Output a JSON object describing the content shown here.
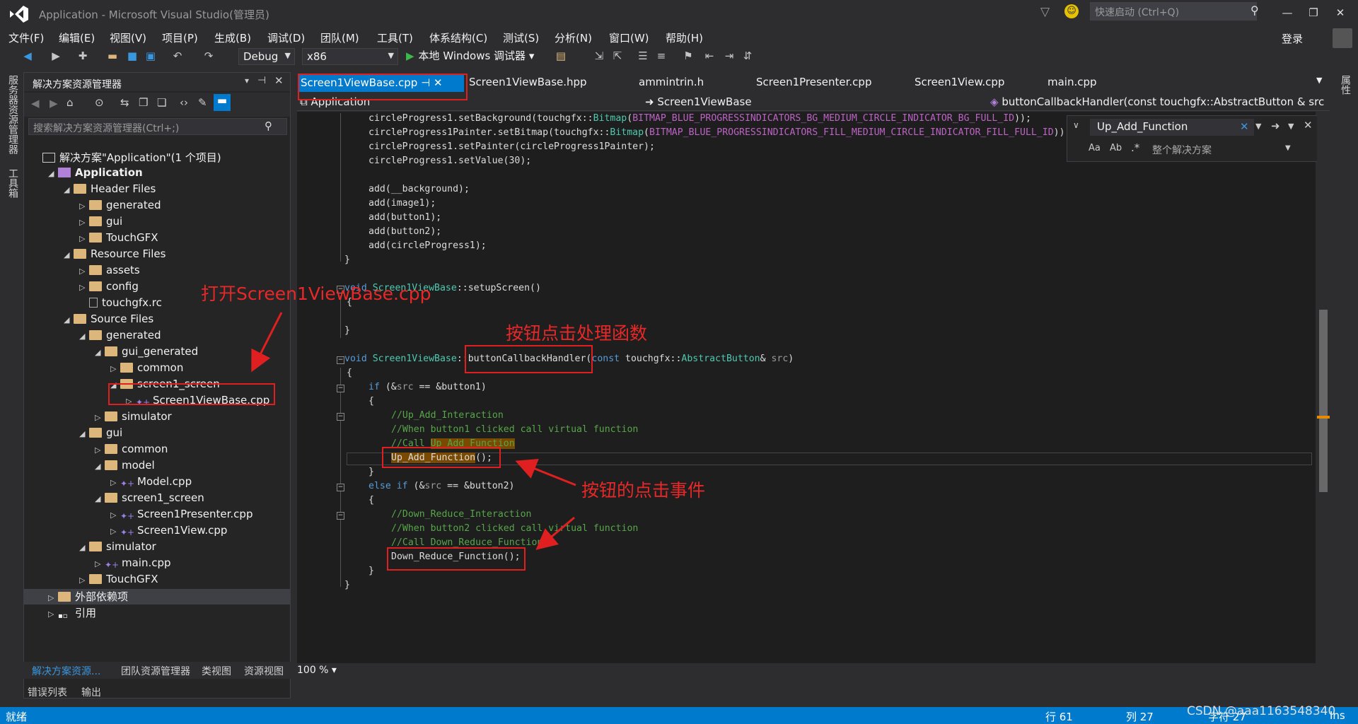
{
  "window": {
    "title": "Application - Microsoft Visual Studio(管理员)",
    "quick_launch_placeholder": "快速启动 (Ctrl+Q)",
    "login": "登录"
  },
  "menu": [
    "文件(F)",
    "编辑(E)",
    "视图(V)",
    "项目(P)",
    "生成(B)",
    "调试(D)",
    "团队(M)",
    "工具(T)",
    "体系结构(C)",
    "测试(S)",
    "分析(N)",
    "窗口(W)",
    "帮助(H)"
  ],
  "toolbar": {
    "config": "Debug",
    "platform": "x86",
    "run_label": "本地 Windows 调试器"
  },
  "left_strip": [
    "服务器资源管理器",
    "工具箱"
  ],
  "right_strip": [
    "属性"
  ],
  "solution_explorer": {
    "title": "解决方案资源管理器",
    "search_placeholder": "搜索解决方案资源管理器(Ctrl+;)",
    "tree": [
      {
        "label": "解决方案\"Application\"(1 个项目)",
        "indent": 0,
        "kind": "solution",
        "tri": ""
      },
      {
        "label": "Application",
        "indent": 1,
        "kind": "project",
        "tri": "◢",
        "bold": true
      },
      {
        "label": "Header Files",
        "indent": 2,
        "kind": "folder",
        "tri": "◢"
      },
      {
        "label": "generated",
        "indent": 3,
        "kind": "folder",
        "tri": "▷"
      },
      {
        "label": "gui",
        "indent": 3,
        "kind": "folder",
        "tri": "▷"
      },
      {
        "label": "TouchGFX",
        "indent": 3,
        "kind": "folder",
        "tri": "▷"
      },
      {
        "label": "Resource Files",
        "indent": 2,
        "kind": "folder",
        "tri": "◢"
      },
      {
        "label": "assets",
        "indent": 3,
        "kind": "folder",
        "tri": "▷"
      },
      {
        "label": "config",
        "indent": 3,
        "kind": "folder",
        "tri": "▷"
      },
      {
        "label": "touchgfx.rc",
        "indent": 3,
        "kind": "file",
        "tri": ""
      },
      {
        "label": "Source Files",
        "indent": 2,
        "kind": "folder",
        "tri": "◢"
      },
      {
        "label": "generated",
        "indent": 3,
        "kind": "folder",
        "tri": "◢"
      },
      {
        "label": "gui_generated",
        "indent": 4,
        "kind": "folder",
        "tri": "◢"
      },
      {
        "label": "common",
        "indent": 5,
        "kind": "folder",
        "tri": "▷"
      },
      {
        "label": "screen1_screen",
        "indent": 5,
        "kind": "folder",
        "tri": "◢"
      },
      {
        "label": "Screen1ViewBase.cpp",
        "indent": 6,
        "kind": "cpp",
        "tri": "▷"
      },
      {
        "label": "simulator",
        "indent": 4,
        "kind": "folder",
        "tri": "▷"
      },
      {
        "label": "gui",
        "indent": 3,
        "kind": "folder",
        "tri": "◢"
      },
      {
        "label": "common",
        "indent": 4,
        "kind": "folder",
        "tri": "▷"
      },
      {
        "label": "model",
        "indent": 4,
        "kind": "folder",
        "tri": "◢"
      },
      {
        "label": "Model.cpp",
        "indent": 5,
        "kind": "cpp",
        "tri": "▷"
      },
      {
        "label": "screen1_screen",
        "indent": 4,
        "kind": "folder",
        "tri": "◢"
      },
      {
        "label": "Screen1Presenter.cpp",
        "indent": 5,
        "kind": "cpp",
        "tri": "▷"
      },
      {
        "label": "Screen1View.cpp",
        "indent": 5,
        "kind": "cpp",
        "tri": "▷"
      },
      {
        "label": "simulator",
        "indent": 3,
        "kind": "folder",
        "tri": "◢"
      },
      {
        "label": "main.cpp",
        "indent": 4,
        "kind": "cpp",
        "tri": "▷"
      },
      {
        "label": "TouchGFX",
        "indent": 3,
        "kind": "folder",
        "tri": "▷"
      },
      {
        "label": "外部依赖项",
        "indent": 1,
        "kind": "folder",
        "tri": "▷",
        "selected": true
      },
      {
        "label": "引用",
        "indent": 1,
        "kind": "ref",
        "tri": "▷"
      }
    ],
    "bottom_tabs": [
      "解决方案资源...",
      "团队资源管理器",
      "类视图",
      "资源视图"
    ]
  },
  "tabs": [
    "Screen1ViewBase.cpp",
    "Screen1ViewBase.hpp",
    "ammintrin.h",
    "Screen1Presenter.cpp",
    "Screen1View.cpp",
    "main.cpp"
  ],
  "nav": {
    "project": "Application",
    "class": "Screen1ViewBase",
    "member": "buttonCallbackHandler(const touchgfx::AbstractButton & src"
  },
  "find": {
    "query": "Up_Add_Function",
    "scope": "整个解决方案"
  },
  "zoom": "100 %",
  "output_tabs": [
    "错误列表",
    "输出"
  ],
  "status": {
    "ready": "就绪",
    "row": "行 61",
    "col": "列 27",
    "char": "字符 27",
    "mode": "Ins",
    "watermark": "CSDN @aaa1163548340"
  },
  "annotations": {
    "open_file": "打开Screen1ViewBase.cpp",
    "handler": "按钮点击处理函数",
    "event": "按钮的点击事件"
  }
}
